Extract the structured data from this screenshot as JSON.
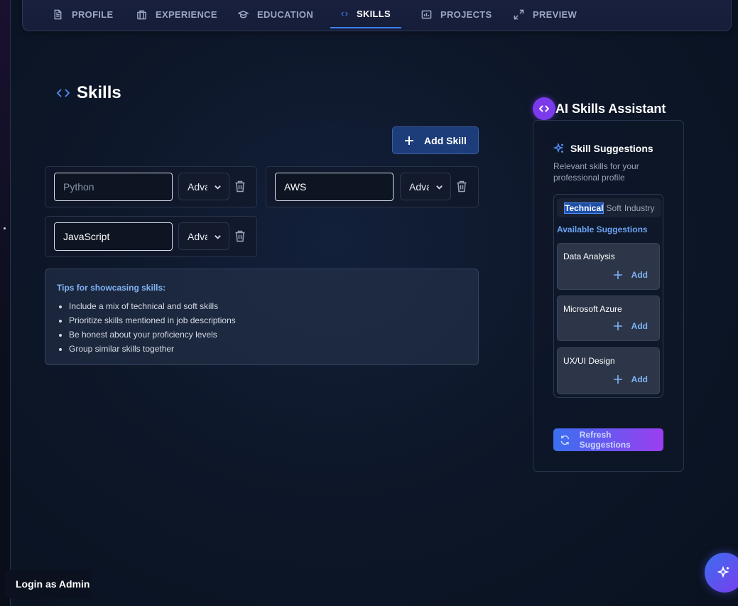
{
  "nav": {
    "tabs": [
      {
        "label": "PROFILE",
        "icon": "document-icon"
      },
      {
        "label": "EXPERIENCE",
        "icon": "briefcase-icon"
      },
      {
        "label": "EDUCATION",
        "icon": "graduation-cap-icon"
      },
      {
        "label": "SKILLS",
        "icon": "code-icon",
        "active": true
      },
      {
        "label": "PROJECTS",
        "icon": "chart-icon"
      },
      {
        "label": "PREVIEW",
        "icon": "expand-icon"
      }
    ]
  },
  "section": {
    "title": "Skills",
    "add_button": "Add Skill"
  },
  "skills": [
    {
      "value": "",
      "placeholder": "Python",
      "level": "Advanced"
    },
    {
      "value": "AWS",
      "placeholder": "",
      "level": "Advanced"
    },
    {
      "value": "JavaScript",
      "placeholder": "",
      "level": "Advanced"
    }
  ],
  "tips": {
    "title": "Tips for showcasing skills:",
    "items": [
      "Include a mix of technical and soft skills",
      "Prioritize skills mentioned in job descriptions",
      "Be honest about your proficiency levels",
      "Group similar skills together"
    ]
  },
  "assistant": {
    "title": "AI Skills Assistant",
    "suggestions_title": "Skill Suggestions",
    "suggestions_subtitle": "Relevant skills for your professional profile",
    "categories": [
      "Technical",
      "Soft",
      "Industry"
    ],
    "available_label": "Available Suggestions",
    "suggestions": [
      {
        "name": "Data Analysis",
        "action": "Add"
      },
      {
        "name": "Microsoft Azure",
        "action": "Add"
      },
      {
        "name": "UX/UI Design",
        "action": "Add"
      }
    ],
    "refresh_button": "Refresh Suggestions"
  },
  "footer": {
    "login_button": "Login as Admin"
  },
  "colors": {
    "accent": "#3b82f6",
    "purple": "#7c3aed"
  }
}
